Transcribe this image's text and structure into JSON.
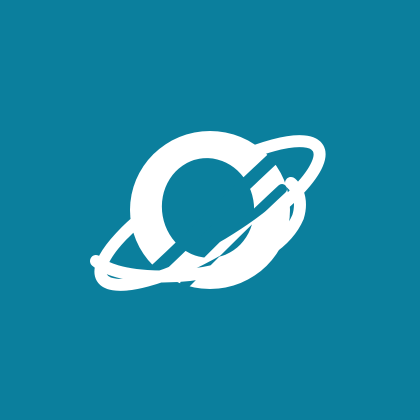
{
  "icon": {
    "name": "planet-icon",
    "background_color": "#0b7f9d",
    "foreground_color": "#ffffff"
  }
}
